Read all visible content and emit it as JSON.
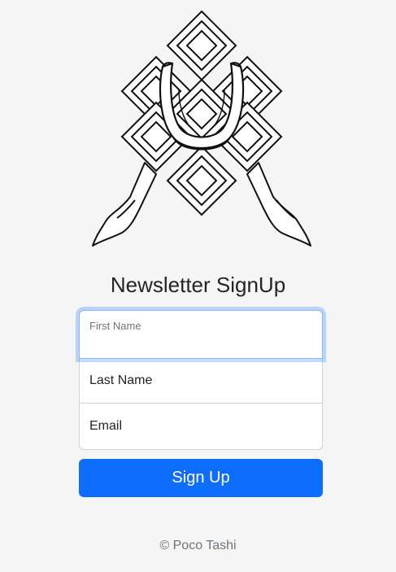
{
  "heading": "Newsletter SignUp",
  "form": {
    "first_name_label": "First Name",
    "last_name_placeholder": "Last Name",
    "email_placeholder": "Email",
    "submit_label": "Sign Up"
  },
  "footer": "© Poco Tashi",
  "colors": {
    "background": "#f5f5f5",
    "primary": "#0d6efd",
    "focus_border": "#86b7fe",
    "text": "#212529",
    "muted": "#6c757d"
  },
  "logo_icon": "endless-knot-icon"
}
